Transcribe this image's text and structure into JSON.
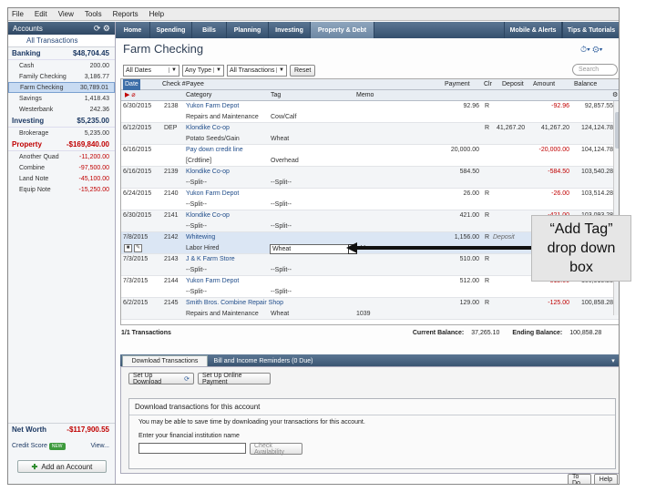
{
  "menu": [
    "File",
    "Edit",
    "View",
    "Tools",
    "Reports",
    "Help"
  ],
  "sidebar": {
    "header": "Accounts",
    "all_transactions": "All Transactions",
    "groups": [
      {
        "name": "Banking",
        "amount": "$48,704.45",
        "items": [
          {
            "name": "Cash",
            "amount": "200.00"
          },
          {
            "name": "Family Checking",
            "amount": "3,186.77"
          },
          {
            "name": "Farm Checking",
            "amount": "30,789.01",
            "selected": true
          },
          {
            "name": "Savings",
            "amount": "1,418.43"
          },
          {
            "name": "Westerbank",
            "amount": "242.36"
          }
        ]
      },
      {
        "name": "Investing",
        "amount": "$5,235.00",
        "items": [
          {
            "name": "Brokerage",
            "amount": "5,235.00"
          }
        ]
      },
      {
        "name": "Property",
        "amount": "-$169,840.00",
        "items": [
          {
            "name": "Another Quad",
            "amount": "-11,200.00"
          },
          {
            "name": "Combine",
            "amount": "-97,500.00"
          },
          {
            "name": "Land Note",
            "amount": "-45,100.00"
          },
          {
            "name": "Equip Note",
            "amount": "-15,250.00"
          }
        ]
      }
    ],
    "net_worth_label": "Net Worth",
    "net_worth": "-$117,900.55",
    "credit_score_label": "Credit Score",
    "credit_badge": "NEW",
    "view_label": "View...",
    "add_account": "Add an Account"
  },
  "nav": {
    "tabs": [
      "Home",
      "Spending",
      "Bills",
      "Planning",
      "Investing",
      "Property & Debt"
    ],
    "active": "Property & Debt",
    "right": [
      "Mobile & Alerts",
      "Tips & Tutorials"
    ]
  },
  "register": {
    "title": "Farm Checking",
    "filters": {
      "dates": "All Dates",
      "type": "Any Type",
      "txn": "All Transactions",
      "reset": "Reset"
    },
    "search_placeholder": "Search",
    "columns": [
      "Date",
      "Check #",
      "Payee",
      "Payment",
      "Clr",
      "Deposit",
      "Amount",
      "Balance"
    ],
    "subcolumns": [
      "Category",
      "Tag",
      "Memo"
    ],
    "rows": [
      {
        "date": "6/30/2015",
        "check": "2138",
        "payee": "Yukon Farm Depot",
        "payment": "92.96",
        "clr": "R",
        "deposit": "",
        "amount": "-92.96",
        "balance": "92,857.55",
        "category": "Repairs and Maintenance",
        "tag": "Cow/Calf",
        "memo": ""
      },
      {
        "date": "6/12/2015",
        "check": "DEP",
        "payee": "Klondike Co-op",
        "payment": "",
        "clr": "R",
        "deposit": "41,267.20",
        "amount": "41,267.20",
        "balance": "124,124.78",
        "category": "Potato Seeds/Gain",
        "tag": "Wheat",
        "memo": ""
      },
      {
        "date": "6/16/2015",
        "check": "",
        "payee": "Pay down credit line",
        "payment": "20,000.00",
        "clr": "",
        "deposit": "",
        "amount": "-20,000.00",
        "balance": "104,124.78",
        "category": "[Crdtline]",
        "tag": "Overhead",
        "memo": ""
      },
      {
        "date": "6/16/2015",
        "check": "2139",
        "payee": "Klondike Co-op",
        "payment": "584.50",
        "clr": "",
        "deposit": "",
        "amount": "-584.50",
        "balance": "103,540.28",
        "category": "--Split--",
        "tag": "--Split--",
        "memo": ""
      },
      {
        "date": "6/24/2015",
        "check": "2140",
        "payee": "Yukon Farm Depot",
        "payment": "26.00",
        "clr": "R",
        "deposit": "",
        "amount": "-26.00",
        "balance": "103,514.28",
        "category": "--Split--",
        "tag": "--Split--",
        "memo": ""
      },
      {
        "date": "6/30/2015",
        "check": "2141",
        "payee": "Klondike Co-op",
        "payment": "421.00",
        "clr": "R",
        "deposit": "",
        "amount": "-421.00",
        "balance": "103,093.28",
        "category": "--Split--",
        "tag": "--Split--",
        "memo": ""
      },
      {
        "date": "7/8/2015",
        "check": "2142",
        "payee": "Whitewing",
        "payment": "1,156.00",
        "clr": "R",
        "deposit": "Deposit",
        "amount": "",
        "balance": "",
        "category": "Labor Hired",
        "tag": "Wheat",
        "memo": "Memo",
        "selected": true
      },
      {
        "date": "7/3/2015",
        "check": "2143",
        "payee": "J & K Farm Store",
        "payment": "510.00",
        "clr": "R",
        "deposit": "",
        "amount": "-510.00",
        "balance": "101,427.28",
        "category": "--Split--",
        "tag": "--Split--",
        "memo": ""
      },
      {
        "date": "7/3/2015",
        "check": "2144",
        "payee": "Yukon Farm Depot",
        "payment": "512.00",
        "clr": "R",
        "deposit": "",
        "amount": "-512.00",
        "balance": "100,915.28",
        "category": "--Split--",
        "tag": "--Split--",
        "memo": ""
      },
      {
        "date": "6/2/2015",
        "check": "2145",
        "payee": "Smith Bros. Combine Repair Shop",
        "payment": "129.00",
        "clr": "R",
        "deposit": "",
        "amount": "-125.00",
        "balance": "100,858.28",
        "category": "Repairs and Maintenance",
        "tag": "Wheat",
        "memo": "1039"
      }
    ],
    "summary": {
      "count": "1/1 Transactions",
      "current_label": "Current Balance:",
      "current": "37,265.10",
      "ending_label": "Ending Balance:",
      "ending": "100,858.28"
    }
  },
  "bottom": {
    "tabs": [
      "Download Transactions",
      "Bill and Income Reminders (0 Due)"
    ],
    "btn_download": "Set Up Download",
    "btn_online": "Set Up Online Payment",
    "box_title": "Download transactions for this account",
    "box_text": "You may be able to save time by downloading your transactions for this account.",
    "fi_label": "Enter your financial institution name",
    "check_btn": "Check Availability",
    "todo": "To Do",
    "help": "Help"
  },
  "callout": {
    "line1": "“Add Tag”",
    "line2": "drop down",
    "line3": "box"
  }
}
